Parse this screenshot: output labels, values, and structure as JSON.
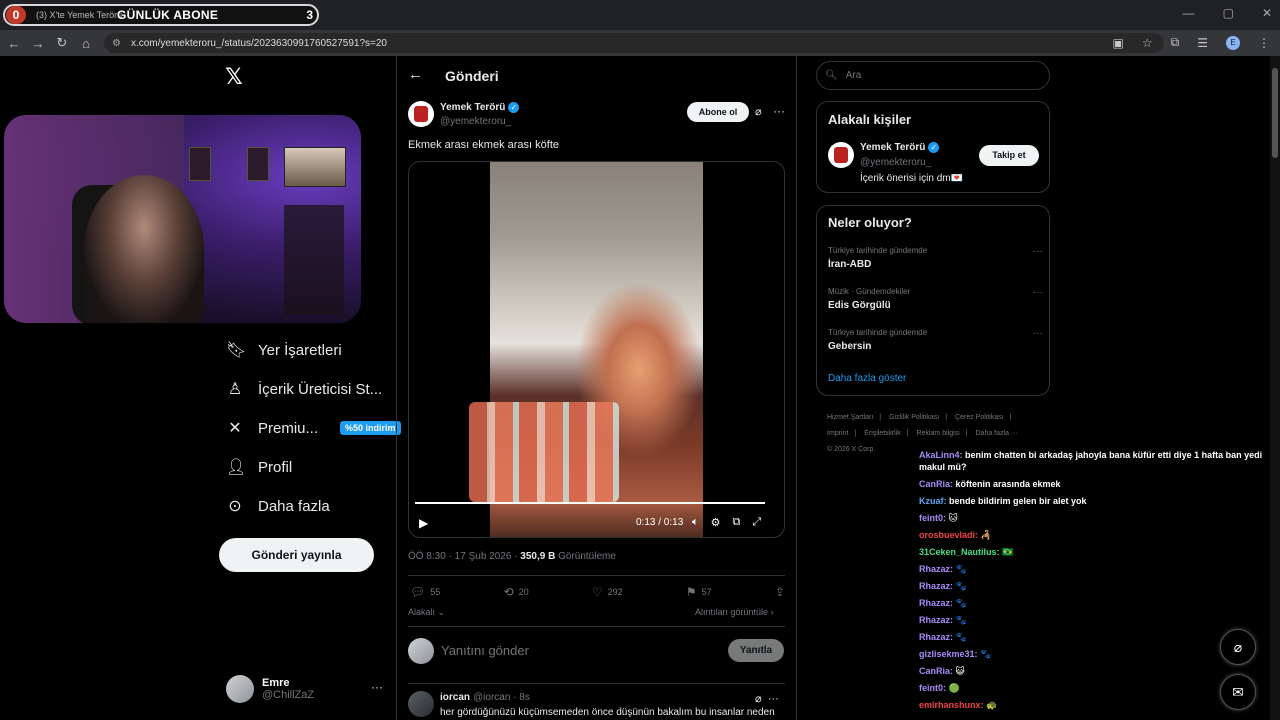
{
  "browser": {
    "tab_title": "(3) X'te Yemek Terörü",
    "overlay_banner": "GÜNLÜK ABONE",
    "overlay_count_left": "0",
    "overlay_count_right": "3",
    "url": "x.com/yemekteroru_/status/2023630991760527591?s=20",
    "profile_initial": "E"
  },
  "nav": {
    "items": [
      {
        "label": "Yer İşaretleri",
        "icon": "bookmark-icon"
      },
      {
        "label": "İçerik Üreticisi St...",
        "icon": "creator-studio-icon"
      },
      {
        "label": "Premiu...",
        "icon": "x-premium-icon",
        "badge": "%50 indirim"
      },
      {
        "label": "Profil",
        "icon": "profile-icon"
      },
      {
        "label": "Daha fazla",
        "icon": "more-circle-icon"
      }
    ],
    "post_button": "Gönderi yayınla",
    "me": {
      "name": "Emre",
      "handle": "@ChillZaZ"
    }
  },
  "post": {
    "page_title": "Gönderi",
    "author_name": "Yemek Terörü",
    "author_handle": "@yemekteroru_",
    "subscribe": "Abone ol",
    "text": "Ekmek arası ekmek arası köfte",
    "video_time": "0:13 / 0:13",
    "video_progress": 1.0,
    "meta_time": "ÖÖ 8:30 · 17 Şub 2026 · ",
    "views": "350,9 B",
    "views_label": " Görüntüleme",
    "stats": {
      "replies": "55",
      "reposts": "20",
      "likes": "292",
      "bookmarks": "57"
    },
    "related": "Alakalı",
    "quotes": "Alıntıları görüntüle",
    "reply_placeholder": "Yanıtını gönder",
    "reply_button": "Yanıtla"
  },
  "comment": {
    "name": "iorcan",
    "handle": "@iorcan",
    "time": "· 8s",
    "text": "her gördüğünüzü küçümsemeden önce düşünün bakalım bu insanlar neden"
  },
  "sidebar": {
    "search_placeholder": "Ara",
    "related_title": "Alakalı kişiler",
    "related_person": {
      "name": "Yemek Terörü",
      "handle": "@yemekteroru_",
      "bio": "İçerik önerisi için dm💌",
      "follow": "Takip et"
    },
    "trends_title": "Neler oluyor?",
    "trends": [
      {
        "context": "Türkiye tarihinde gündemde",
        "name": "İran-ABD"
      },
      {
        "context": "Müzik · Gündemdekiler",
        "name": "Edis Görgülü"
      },
      {
        "context": "Türkiye tarihinde gündemde",
        "name": "Gebersin"
      }
    ],
    "show_more": "Daha fazla göster",
    "footer": [
      "Hizmet Şartları",
      "|",
      "Gizlilik Politikası",
      "|",
      "Çerez Politikası",
      "|",
      "Imprint",
      "|",
      "Erişilebilirlik",
      "|",
      "Reklam bilgisi",
      "|",
      "Daha fazla ···",
      "© 2026 X Corp."
    ]
  },
  "chat": [
    {
      "user": "AkaLinn4:",
      "text": " benim chatten bi arkadaş jahoyla bana küfür etti diye 1 hafta ban yedi makul mü?",
      "color": "u-p"
    },
    {
      "user": "CanRia:",
      "text": " köftenin arasında ekmek",
      "color": "u-p"
    },
    {
      "user": "Kzuaf:",
      "text": " bende bildirim gelen bir alet yok",
      "color": "u-b"
    },
    {
      "user": "feint0:",
      "text": " 🐱",
      "color": "u-p"
    },
    {
      "user": "orosbuevladi:",
      "text": " 🦂",
      "color": "u-r"
    },
    {
      "user": "31Ceken_Nautilus:",
      "text": " 🇧🇷",
      "color": "u-g"
    },
    {
      "user": "Rhazaz:",
      "text": " 🐾",
      "color": "u-p"
    },
    {
      "user": "Rhazaz:",
      "text": " 🐾",
      "color": "u-p"
    },
    {
      "user": "Rhazaz:",
      "text": " 🐾",
      "color": "u-p"
    },
    {
      "user": "Rhazaz:",
      "text": " 🐾",
      "color": "u-p"
    },
    {
      "user": "Rhazaz:",
      "text": " 🐾",
      "color": "u-p"
    },
    {
      "user": "gizlisekme31:",
      "text": " 🐾",
      "color": "u-p"
    },
    {
      "user": "CanRia:",
      "text": " 😺",
      "color": "u-p"
    },
    {
      "user": "feint0:",
      "text": " 🟢",
      "color": "u-p"
    },
    {
      "user": "emirhanshunx:",
      "text": " 🐢",
      "color": "u-r"
    }
  ],
  "colors": {
    "accent": "#1d9bf0",
    "bg": "#000000",
    "border": "#2f3336",
    "muted": "#71767b"
  }
}
